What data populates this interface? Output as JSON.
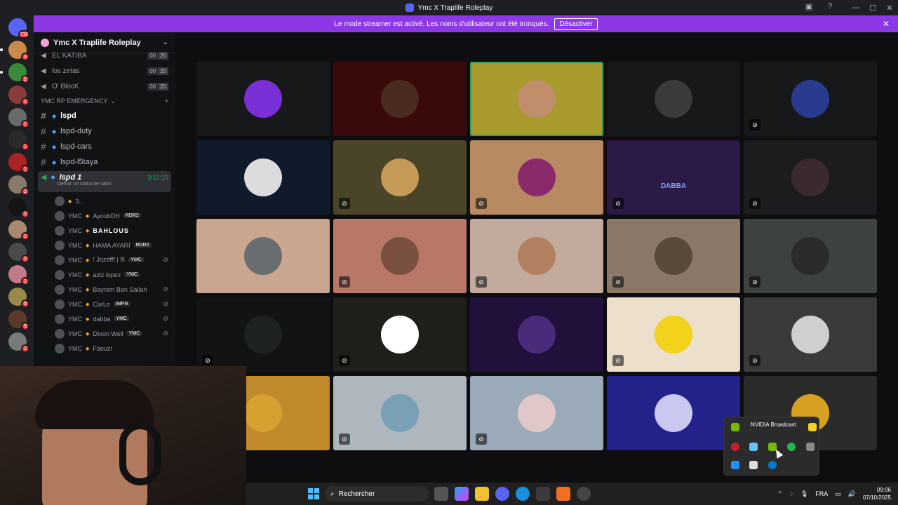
{
  "window": {
    "title": "Ymc X Traplife Roleplay",
    "controls": [
      "—",
      "☐",
      "✕"
    ]
  },
  "banner": {
    "text": "Le mode streamer est activé. Les noms d'utilisateur ont été tronqués.",
    "button": "Désactiver"
  },
  "rail": {
    "top_badge": "715",
    "badges": [
      "3",
      "2",
      "1",
      "1",
      "1",
      "1",
      "2",
      "2",
      "2",
      "2",
      "1",
      "5",
      "5",
      "2"
    ]
  },
  "server": {
    "name": "Ymc X Traplife Roleplay"
  },
  "voice_channels": [
    {
      "name": "EL KATIBA",
      "a": "00",
      "b": "20"
    },
    {
      "name": "los zetas",
      "a": "00",
      "b": "20"
    },
    {
      "name": "O' BlocK",
      "a": "00",
      "b": "20"
    }
  ],
  "category": {
    "label": "YMC RP EMERGENCY"
  },
  "text_channels": [
    {
      "name": "lspd",
      "bold": true
    },
    {
      "name": "lspd-duty",
      "bold": false
    },
    {
      "name": "lspd-cars",
      "bold": false
    },
    {
      "name": "lspd-l5taya",
      "bold": false
    }
  ],
  "active_channel": {
    "name": "lspd 1",
    "time": "3:11:15",
    "status": "Définir un statut de salon"
  },
  "members": [
    {
      "prefix": "",
      "name": "3...",
      "tag": "",
      "muted": false
    },
    {
      "prefix": "YMC",
      "name": "AyoubDH",
      "tag": "RDR2",
      "muted": false
    },
    {
      "prefix": "YMC",
      "name": "BAHLOUS",
      "tag": "",
      "muted": false
    },
    {
      "prefix": "YMC",
      "name": "HAMA AYARI",
      "tag": "RDR2",
      "muted": false
    },
    {
      "prefix": "YMC",
      "name": "! Jozéfff | ℜ",
      "tag": "YMC",
      "muted": true
    },
    {
      "prefix": "YMC",
      "name": "aziz lopez",
      "tag": "YMC",
      "muted": false
    },
    {
      "prefix": "YMC",
      "name": "Bayrem Ben Sallah",
      "tag": "",
      "muted": true
    },
    {
      "prefix": "YMC",
      "name": "CarLo",
      "tag": "IMPR",
      "muted": true
    },
    {
      "prefix": "YMC",
      "name": "dabba",
      "tag": "YMC",
      "muted": true
    },
    {
      "prefix": "YMC",
      "name": "DIxon Well",
      "tag": "YMC",
      "muted": true
    },
    {
      "prefix": "YMC",
      "name": "Faouzi",
      "tag": "",
      "muted": false
    }
  ],
  "tiles": [
    {
      "bg": "#17181a",
      "pic": "#7b2fd6",
      "muted": false,
      "speaking": false,
      "label": ""
    },
    {
      "bg": "#3a0a0a",
      "pic": "#4a2a20",
      "muted": false,
      "speaking": false,
      "label": ""
    },
    {
      "bg": "#a89a2c",
      "pic": "#c08e6a",
      "muted": false,
      "speaking": true,
      "label": ""
    },
    {
      "bg": "#17181a",
      "pic": "#3a3a3a",
      "muted": false,
      "speaking": false,
      "label": ""
    },
    {
      "bg": "#17181a",
      "pic": "#2a3b8f",
      "muted": true,
      "speaking": false,
      "label": ""
    },
    {
      "bg": "#0f1a2a",
      "pic": "#dcdcdc",
      "muted": false,
      "speaking": false,
      "label": ""
    },
    {
      "bg": "#4a4528",
      "pic": "#c49a56",
      "muted": true,
      "speaking": false,
      "label": ""
    },
    {
      "bg": "#b88a62",
      "pic": "#8a2a6a",
      "muted": true,
      "speaking": false,
      "label": ""
    },
    {
      "bg": "#2a1a45",
      "pic": "#2a1a45",
      "muted": true,
      "speaking": false,
      "label": "DABBA"
    },
    {
      "bg": "#1c1c1e",
      "pic": "#3a2a30",
      "muted": true,
      "speaking": false,
      "label": ""
    },
    {
      "bg": "#c9a690",
      "pic": "#6a6e70",
      "muted": false,
      "speaking": false,
      "label": ""
    },
    {
      "bg": "#b87868",
      "pic": "#7a5040",
      "muted": true,
      "speaking": false,
      "label": ""
    },
    {
      "bg": "#c2aa9c",
      "pic": "#b08060",
      "muted": true,
      "speaking": false,
      "label": ""
    },
    {
      "bg": "#8a7868",
      "pic": "#5a4a3a",
      "muted": true,
      "speaking": false,
      "label": ""
    },
    {
      "bg": "#3e423e",
      "pic": "#2a2a2a",
      "muted": true,
      "speaking": false,
      "label": ""
    },
    {
      "bg": "#121413",
      "pic": "#1e2220",
      "muted": true,
      "speaking": false,
      "label": ""
    },
    {
      "bg": "#1e1e1a",
      "pic": "#ffffff",
      "muted": true,
      "speaking": false,
      "label": ""
    },
    {
      "bg": "#20103a",
      "pic": "#4a2a7a",
      "muted": false,
      "speaking": false,
      "label": ""
    },
    {
      "bg": "#ece0cc",
      "pic": "#f2d21b",
      "muted": true,
      "speaking": false,
      "label": ""
    },
    {
      "bg": "#3a3a3a",
      "pic": "#cfcfcf",
      "muted": true,
      "speaking": false,
      "label": ""
    },
    {
      "bg": "#c08a2a",
      "pic": "#d8a030",
      "muted": false,
      "speaking": false,
      "label": ""
    },
    {
      "bg": "#aeb6be",
      "pic": "#7aa0b8",
      "muted": true,
      "speaking": false,
      "label": ""
    },
    {
      "bg": "#9aaab8",
      "pic": "#e0c8c8",
      "muted": true,
      "speaking": false,
      "label": ""
    },
    {
      "bg": "#22228a",
      "pic": "#c8c8f0",
      "muted": false,
      "speaking": false,
      "label": ""
    },
    {
      "bg": "#2a2a2a",
      "pic": "#d8a020",
      "muted": false,
      "speaking": false,
      "label": ""
    }
  ],
  "taskbar": {
    "search_placeholder": "Rechercher",
    "lang": "FRA",
    "time": "09:06",
    "date": "07/10/2025"
  },
  "tray_flyout": {
    "tooltip": "NVIDIA Broadcast"
  }
}
